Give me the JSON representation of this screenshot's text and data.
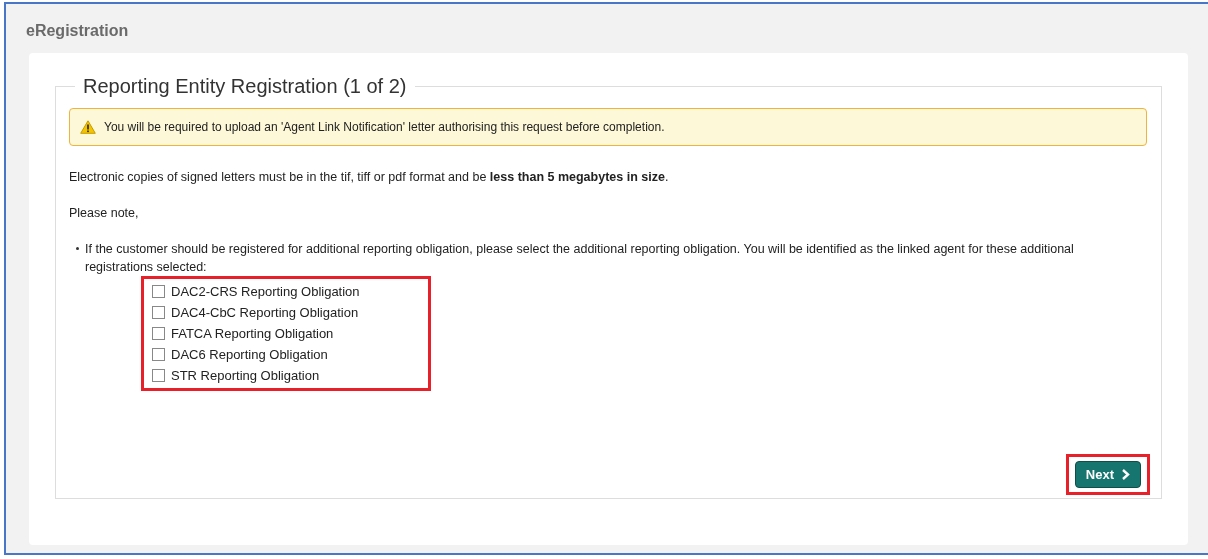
{
  "header": {
    "title": "eRegistration"
  },
  "form": {
    "legend": "Reporting Entity Registration (1 of 2)",
    "warning": "You will be required to upload an 'Agent Link Notification' letter authorising this request before completion.",
    "intro": "Electronic copies of signed letters must be in the tif, tiff or pdf format and be **less than 5 megabytes in size**.",
    "note": "Please note,",
    "bullet": "If the customer should be registered for additional reporting obligation, please select the additional reporting obligation. You will be identified as the linked agent for these additional registrations selected:",
    "obligations": [
      {
        "label": "DAC2-CRS Reporting Obligation",
        "checked": false
      },
      {
        "label": "DAC4-CbC Reporting Obligation",
        "checked": false
      },
      {
        "label": "FATCA Reporting Obligation",
        "checked": false
      },
      {
        "label": "DAC6 Reporting Obligation",
        "checked": false
      },
      {
        "label": "STR Reporting Obligation",
        "checked": false
      }
    ],
    "next_button": "Next"
  }
}
